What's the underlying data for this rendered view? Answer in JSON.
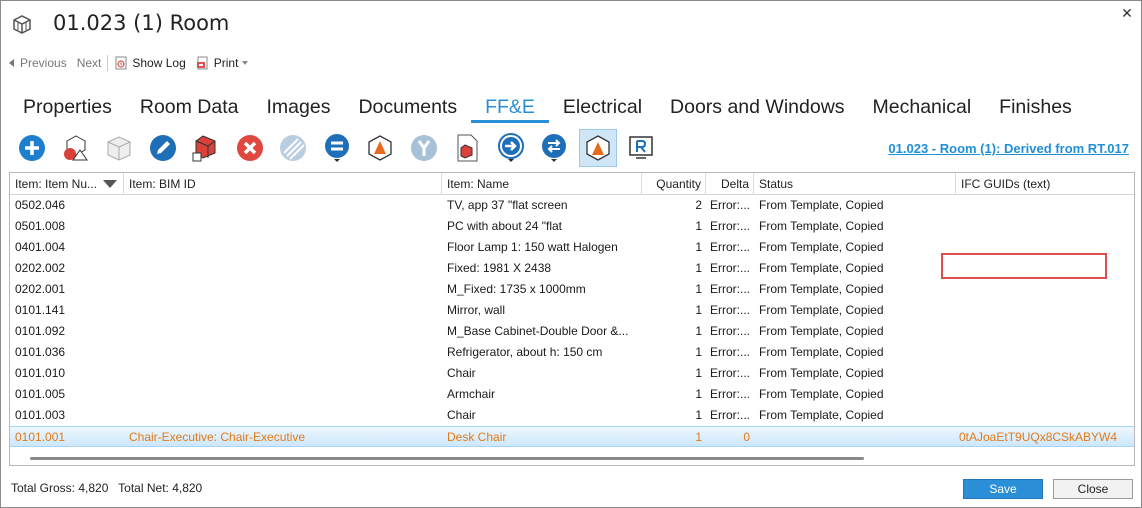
{
  "window": {
    "title": "01.023 (1) Room",
    "close_glyph": "✕"
  },
  "navbar": {
    "previous": "Previous",
    "next": "Next",
    "show_log": "Show Log",
    "print": "Print"
  },
  "tabs": [
    {
      "label": "Properties",
      "active": false
    },
    {
      "label": "Room Data",
      "active": false
    },
    {
      "label": "Images",
      "active": false
    },
    {
      "label": "Documents",
      "active": false
    },
    {
      "label": "FF&E",
      "active": true
    },
    {
      "label": "Electrical",
      "active": false
    },
    {
      "label": "Doors and Windows",
      "active": false
    },
    {
      "label": "Mechanical",
      "active": false
    },
    {
      "label": "Finishes",
      "active": false
    }
  ],
  "toolbar": {
    "icons": [
      "add-icon",
      "add-shapes-icon",
      "add-box-icon",
      "edit-icon",
      "add-3d-object-icon",
      "delete-icon",
      "disabled-hatch-icon",
      "equals-dropdown-icon",
      "revit-object-icon",
      "merge-icon",
      "object-document-icon",
      "arrow-right-dropdown-icon",
      "sync-dropdown-icon",
      "show-in-revit-icon",
      "revit-link-icon"
    ],
    "derived_link": "01.023 - Room (1): Derived from RT.017"
  },
  "grid": {
    "columns": [
      "Item: Item Nu...",
      "Item: BIM ID",
      "Item: Name",
      "Quantity",
      "Delta",
      "Status",
      "IFC GUIDs (text)"
    ],
    "rows": [
      {
        "number": "0502.046",
        "bim_id": "",
        "name": "TV, app 37 \"flat screen",
        "quantity": "2",
        "delta": "Error:...",
        "status": "From Template, Copied",
        "guid": ""
      },
      {
        "number": "0501.008",
        "bim_id": "",
        "name": "PC with about 24 \"flat",
        "quantity": "1",
        "delta": "Error:...",
        "status": "From Template, Copied",
        "guid": ""
      },
      {
        "number": "0401.004",
        "bim_id": "",
        "name": "Floor Lamp 1: 150 watt Halogen",
        "quantity": "1",
        "delta": "Error:...",
        "status": "From Template, Copied",
        "guid": ""
      },
      {
        "number": "0202.002",
        "bim_id": "",
        "name": "Fixed: 1981 X 2438",
        "quantity": "1",
        "delta": "Error:...",
        "status": "From Template, Copied",
        "guid": ""
      },
      {
        "number": "0202.001",
        "bim_id": "",
        "name": "M_Fixed: 1735 x 1000mm",
        "quantity": "1",
        "delta": "Error:...",
        "status": "From Template, Copied",
        "guid": ""
      },
      {
        "number": "0101.141",
        "bim_id": "",
        "name": "Mirror, wall",
        "quantity": "1",
        "delta": "Error:...",
        "status": "From Template, Copied",
        "guid": ""
      },
      {
        "number": "0101.092",
        "bim_id": "",
        "name": "M_Base Cabinet-Double Door &...",
        "quantity": "1",
        "delta": "Error:...",
        "status": "From Template, Copied",
        "guid": ""
      },
      {
        "number": "0101.036",
        "bim_id": "",
        "name": "Refrigerator, about h: 150 cm",
        "quantity": "1",
        "delta": "Error:...",
        "status": "From Template, Copied",
        "guid": ""
      },
      {
        "number": "0101.010",
        "bim_id": "",
        "name": "Chair",
        "quantity": "1",
        "delta": "Error:...",
        "status": "From Template, Copied",
        "guid": ""
      },
      {
        "number": "0101.005",
        "bim_id": "",
        "name": "Armchair",
        "quantity": "1",
        "delta": "Error:...",
        "status": "From Template, Copied",
        "guid": ""
      },
      {
        "number": "0101.003",
        "bim_id": "",
        "name": "Chair",
        "quantity": "1",
        "delta": "Error:...",
        "status": "From Template, Copied",
        "guid": ""
      },
      {
        "number": "0101.001",
        "bim_id": "Chair-Executive: Chair-Executive",
        "name": "Desk Chair",
        "quantity": "1",
        "delta": "0",
        "status": "",
        "guid": "0tAJoaEtT9UQx8CSkABYW4",
        "selected": true
      }
    ]
  },
  "footer": {
    "totals": "Total Gross: 4,820   Total Net: 4,820",
    "save": "Save",
    "close": "Close"
  },
  "colors": {
    "accent": "#2a8fd6",
    "selected_text": "#e07b1a",
    "highlight_box": "#e04b4b"
  }
}
